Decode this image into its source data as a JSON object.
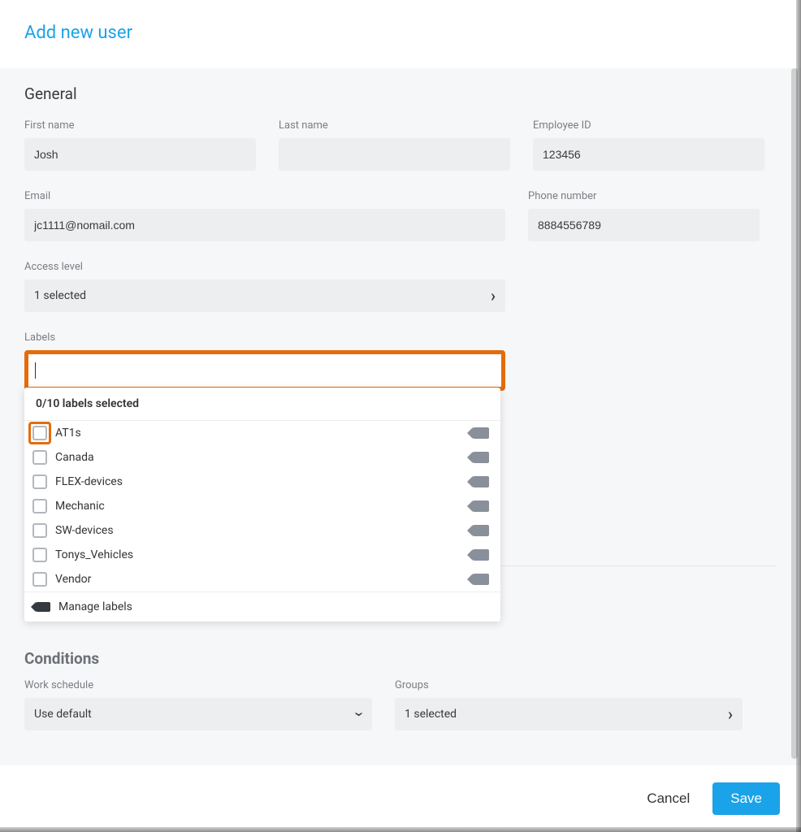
{
  "header": {
    "title": "Add new user"
  },
  "general": {
    "section_title": "General",
    "first_name": {
      "label": "First name",
      "value": "Josh"
    },
    "last_name": {
      "label": "Last name",
      "value": " "
    },
    "employee_id": {
      "label": "Employee ID",
      "value": "123456"
    },
    "email": {
      "label": "Email",
      "value": "jc1111@nomail.com"
    },
    "phone": {
      "label": "Phone number",
      "value": "8884556789"
    },
    "access_level": {
      "label": "Access level",
      "display": "1 selected"
    },
    "labels": {
      "label": "Labels",
      "selected_count_text": "0/10 labels selected",
      "options": [
        {
          "name": "AT1s"
        },
        {
          "name": "Canada"
        },
        {
          "name": "FLEX-devices"
        },
        {
          "name": "Mechanic"
        },
        {
          "name": "SW-devices"
        },
        {
          "name": "Tonys_Vehicles"
        },
        {
          "name": "Vendor"
        }
      ],
      "manage_text": "Manage labels"
    }
  },
  "conditions": {
    "section_title": "Conditions",
    "work_schedule": {
      "label": "Work schedule",
      "display": "Use default"
    },
    "groups": {
      "label": "Groups",
      "display": "1 selected"
    }
  },
  "footer": {
    "cancel": "Cancel",
    "save": "Save"
  }
}
